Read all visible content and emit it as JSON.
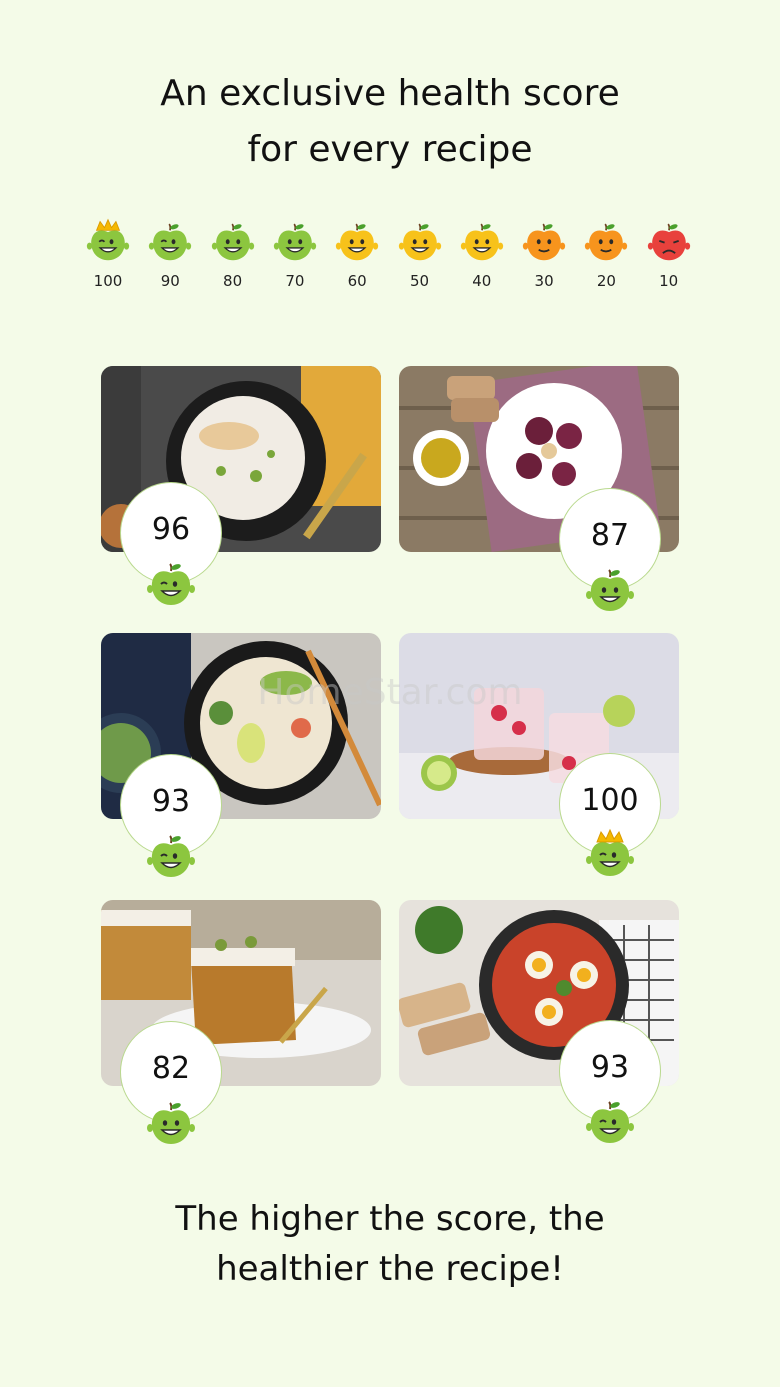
{
  "headline": {
    "line1": "An exclusive health score",
    "line2": "for every recipe"
  },
  "scale": [
    {
      "value": "100",
      "color": "#8cc63f",
      "mood": "crown"
    },
    {
      "value": "90",
      "color": "#8cc63f",
      "mood": "wink"
    },
    {
      "value": "80",
      "color": "#8cc63f",
      "mood": "smile"
    },
    {
      "value": "70",
      "color": "#8cc63f",
      "mood": "smile"
    },
    {
      "value": "60",
      "color": "#f7c21a",
      "mood": "smile"
    },
    {
      "value": "50",
      "color": "#f7c21a",
      "mood": "smile"
    },
    {
      "value": "40",
      "color": "#f7c21a",
      "mood": "smile"
    },
    {
      "value": "30",
      "color": "#f7941d",
      "mood": "neutral"
    },
    {
      "value": "20",
      "color": "#f7941d",
      "mood": "neutral"
    },
    {
      "value": "10",
      "color": "#e8413c",
      "mood": "sad"
    }
  ],
  "recipes": [
    {
      "score": "96",
      "face": "wink",
      "photo": "rice-bowl-with-pear"
    },
    {
      "score": "87",
      "face": "smile",
      "photo": "beetroot-carpaccio"
    },
    {
      "score": "93",
      "face": "wink",
      "photo": "noodle-salad-bowl"
    },
    {
      "score": "100",
      "face": "crown",
      "photo": "raspberry-lime-water"
    },
    {
      "score": "82",
      "face": "smile",
      "photo": "carrot-cake-slice"
    },
    {
      "score": "93",
      "face": "wink",
      "photo": "shakshuka-pan"
    }
  ],
  "watermark": "HomeStar.com",
  "footer": {
    "line1": "The higher the score, the",
    "line2": "healthier the recipe!"
  },
  "colors": {
    "background": "#f4fbe8",
    "apple_green": "#8cc63f",
    "apple_yellow": "#f7c21a",
    "apple_orange": "#f7941d",
    "apple_red": "#e8413c",
    "crown_gold": "#f5b800"
  }
}
